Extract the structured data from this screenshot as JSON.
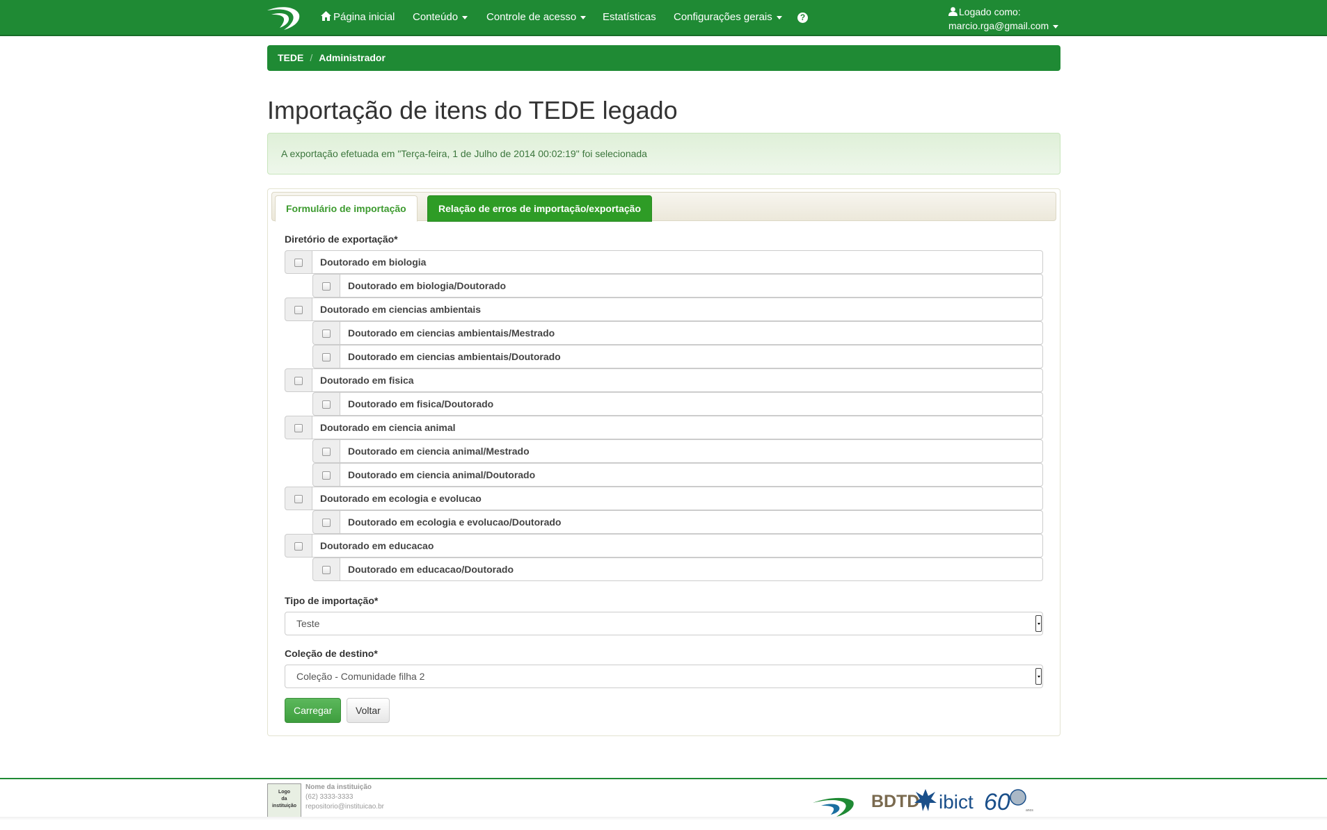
{
  "navbar": {
    "home": "Página inicial",
    "conteudo": "Conteúdo",
    "acesso": "Controle de acesso",
    "estatisticas": "Estatísticas",
    "config": "Configurações gerais",
    "help": "?",
    "user_label": "Logado como:",
    "user_email": "marcio.rga@gmail.com"
  },
  "breadcrumb": {
    "root": "TEDE",
    "current": "Administrador"
  },
  "page_title": "Importação de itens do TEDE legado",
  "alert": "A exportação efetuada em \"Terça-feira, 1 de Julho de 2014 00:02:19\" foi selecionada",
  "tabs": {
    "form": "Formulário de importação",
    "errors": "Relação de erros de importação/exportação"
  },
  "form": {
    "dir_label": "Diretório de exportação*",
    "directories": [
      {
        "label": "Doutorado em biologia",
        "level": 0
      },
      {
        "label": "Doutorado em biologia/Doutorado",
        "level": 1
      },
      {
        "label": "Doutorado em ciencias ambientais",
        "level": 0
      },
      {
        "label": "Doutorado em ciencias ambientais/Mestrado",
        "level": 1
      },
      {
        "label": "Doutorado em ciencias ambientais/Doutorado",
        "level": 1
      },
      {
        "label": "Doutorado em fisica",
        "level": 0
      },
      {
        "label": "Doutorado em fisica/Doutorado",
        "level": 1
      },
      {
        "label": "Doutorado em ciencia animal",
        "level": 0
      },
      {
        "label": "Doutorado em ciencia animal/Mestrado",
        "level": 1
      },
      {
        "label": "Doutorado em ciencia animal/Doutorado",
        "level": 1
      },
      {
        "label": "Doutorado em ecologia e evolucao",
        "level": 0
      },
      {
        "label": "Doutorado em ecologia e evolucao/Doutorado",
        "level": 1
      },
      {
        "label": "Doutorado em educacao",
        "level": 0
      },
      {
        "label": "Doutorado em educacao/Doutorado",
        "level": 1
      }
    ],
    "tipo_label": "Tipo de importação*",
    "tipo_value": "Teste",
    "colecao_label": "Coleção de destino*",
    "colecao_value": "Coleção - Comunidade filha 2",
    "submit": "Carregar",
    "back": "Voltar"
  },
  "footer": {
    "logo_lines": [
      "Logo",
      "da",
      "instituição"
    ],
    "inst_name": "Nome da instituição",
    "inst_phone": "(62) 3333-3333",
    "inst_email": "repositorio@instituicao.br",
    "bdtd": "BDTD",
    "ibict": "ibict",
    "ibict_years": "60",
    "anos": "anos"
  },
  "colors": {
    "brand_green": "#1f8a34",
    "tab_green": "#2e9c26",
    "alert_text": "#3c763d"
  }
}
